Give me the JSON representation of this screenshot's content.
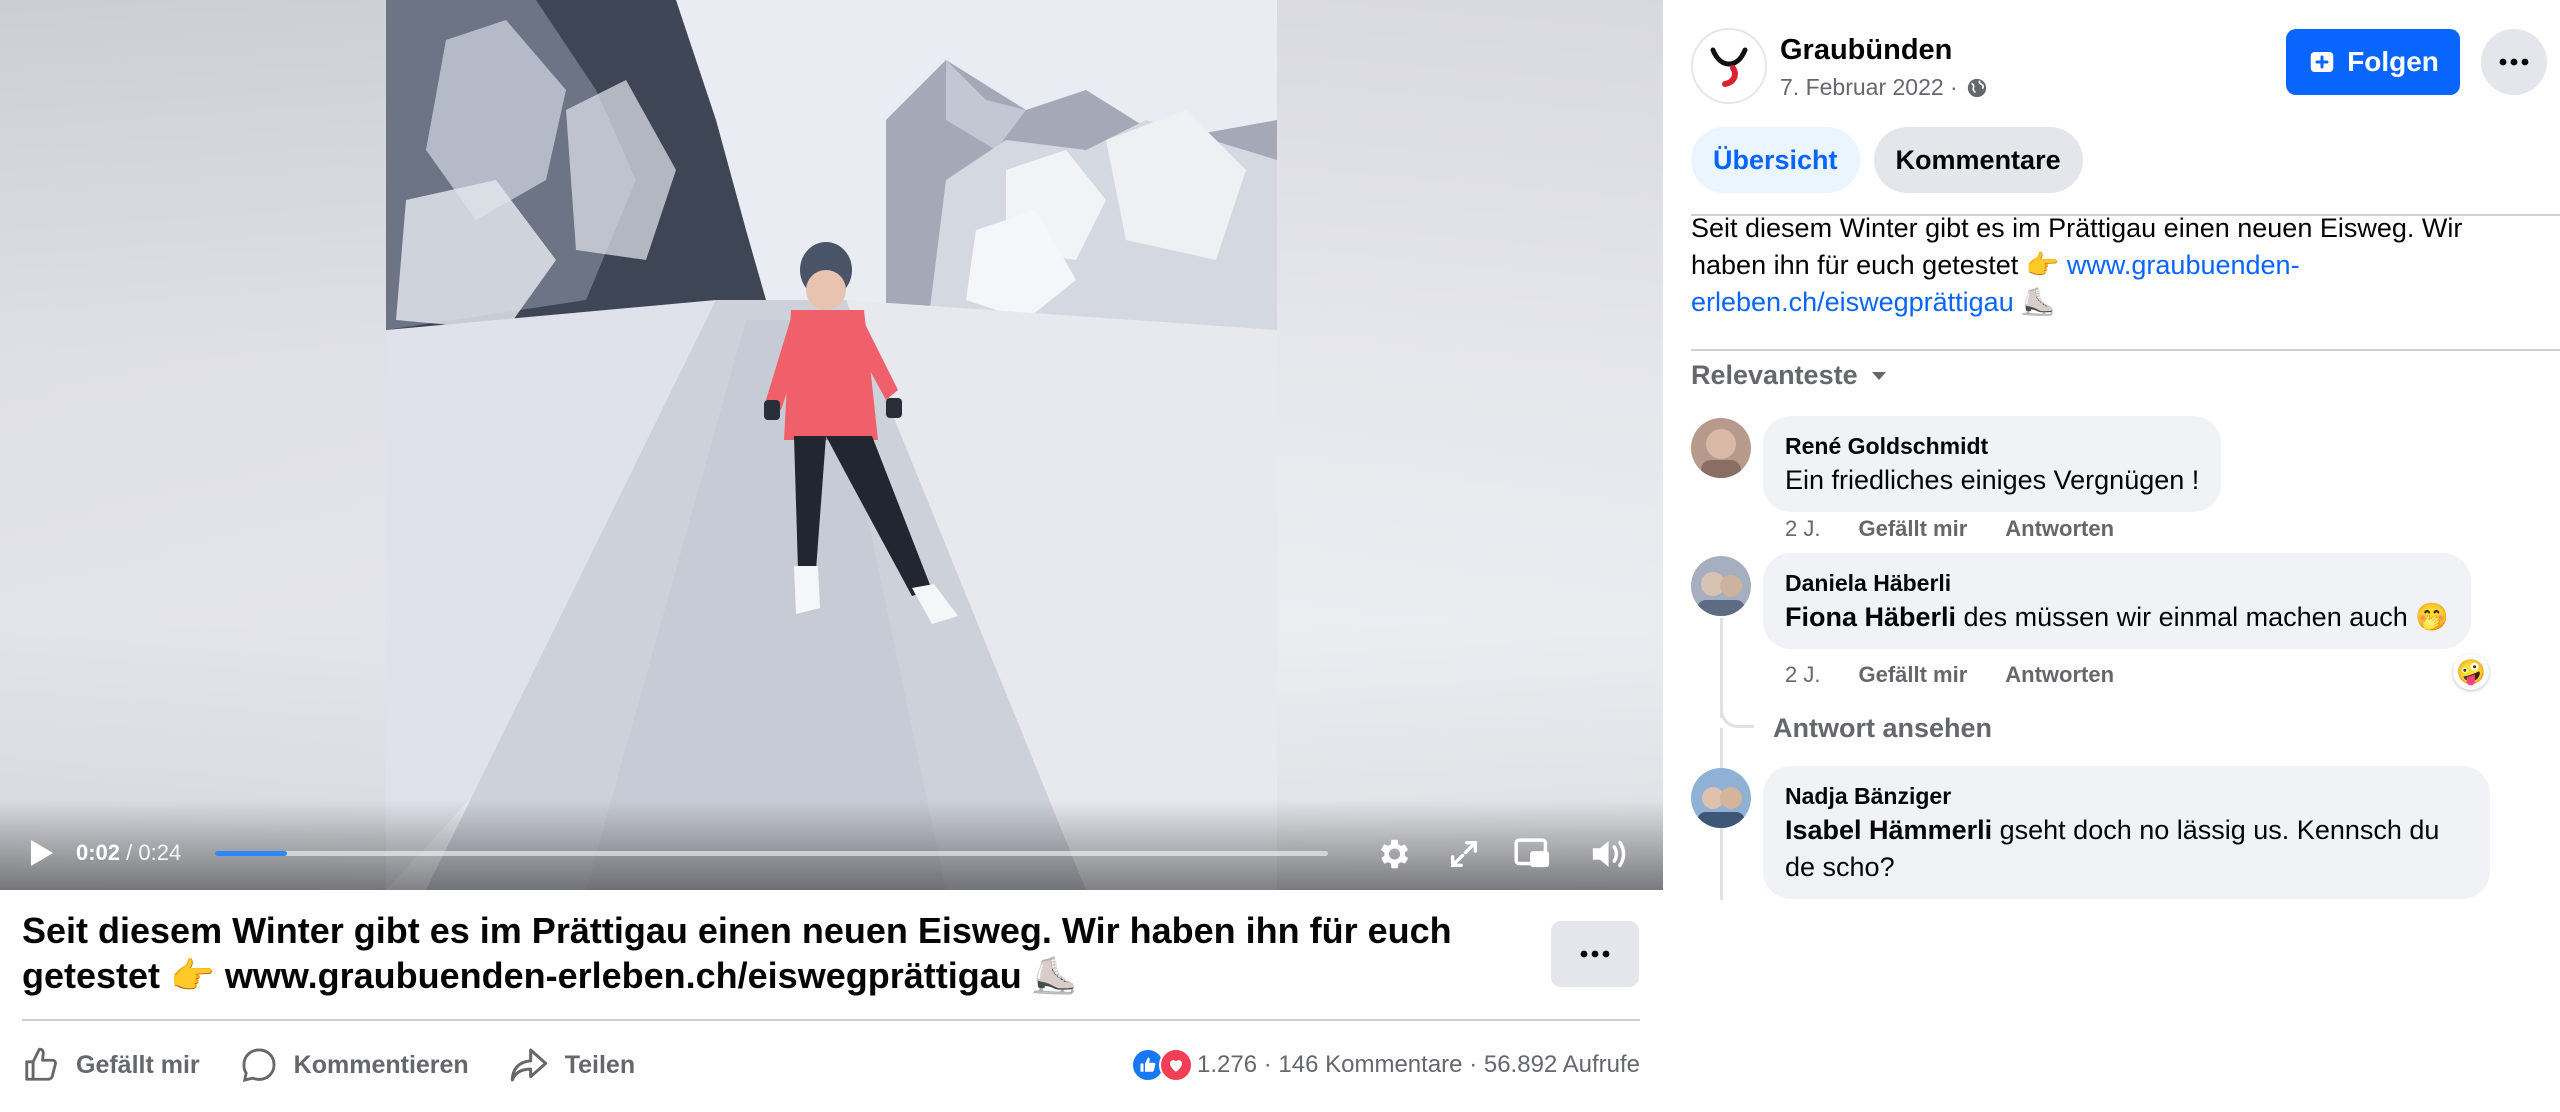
{
  "video": {
    "current_time": "0:02",
    "separator": "/",
    "duration": "0:24",
    "progress_fraction": 0.065
  },
  "caption": {
    "text": "Seit diesem Winter gibt es im Prättigau einen neuen Eisweg. Wir haben ihn für euch getestet",
    "emoji_point": "👉",
    "link": "www.graubuenden-erleben.ch/eiswegprättigau",
    "emoji_skate": "⛸️"
  },
  "actions": {
    "like": "Gefällt mir",
    "comment": "Kommentieren",
    "share": "Teilen"
  },
  "stats": {
    "reactions": "1.276",
    "comments": "146 Kommentare",
    "views": "56.892 Aufrufe",
    "dot": "·"
  },
  "page": {
    "name": "Graubünden",
    "date": "7. Februar 2022 ·",
    "follow_label": "Folgen"
  },
  "tabs": {
    "overview": "Übersicht",
    "comments": "Kommentare"
  },
  "post": {
    "text": "Seit diesem Winter gibt es im Prättigau einen neuen Eisweg. Wir haben ihn für euch getestet",
    "emoji_point": "👉",
    "link": "www.graubuenden-erleben.ch/eiswegprättigau",
    "emoji_skate": "⛸️"
  },
  "sort_label": "Relevanteste",
  "comments": [
    {
      "author": "René Goldschmidt",
      "text": "Ein friedliches einiges Vergnügen !",
      "age": "2 J.",
      "like": "Gefällt mir",
      "reply": "Antworten"
    },
    {
      "author": "Daniela Häberli",
      "mention": "Fiona Häberli",
      "text": "des müssen wir einmal machen auch",
      "emoji": "🤭",
      "age": "2 J.",
      "like": "Gefällt mir",
      "reply": "Antworten",
      "reaction": "🤪",
      "see_reply": "Antwort ansehen"
    },
    {
      "author": "Nadja Bänziger",
      "mention": "Isabel Hämmerli",
      "text": "gseht doch no lässig us. Kennsch du de scho?"
    }
  ],
  "colors": {
    "accent": "#0866ff",
    "like_blue": "#1877f2",
    "love_red": "#f33e58",
    "jacket": "#f0606a",
    "muted": "#65676b"
  }
}
